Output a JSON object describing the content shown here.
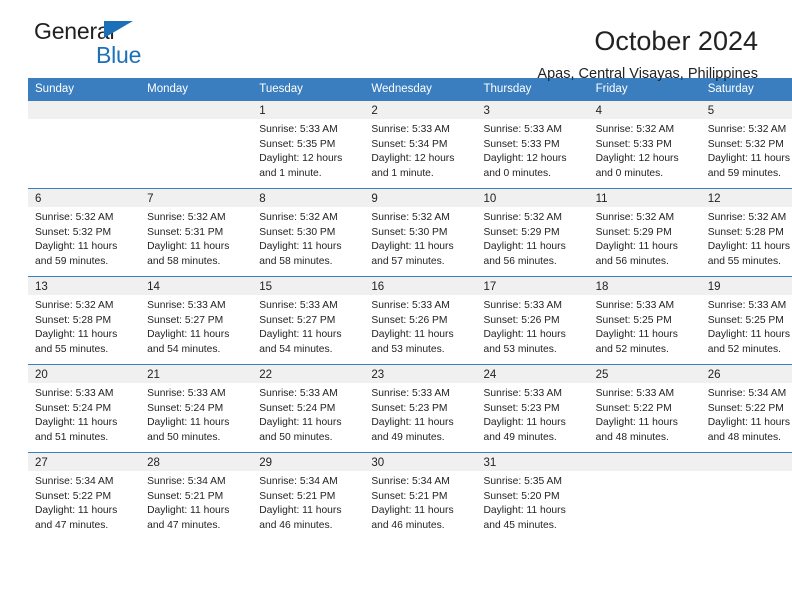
{
  "brand": {
    "line1": "General",
    "line2": "Blue",
    "triangle_color": "#1b70b8",
    "text_color": "#231f20"
  },
  "header": {
    "title": "October 2024",
    "subtitle": "Apas, Central Visayas, Philippines"
  },
  "theme": {
    "header_blue": "#3a7ebf",
    "daynum_bg": "#f0f0f0",
    "grid_line": "#3a7ebf",
    "text": "#232323"
  },
  "calendar": {
    "weekday_headers": [
      "Sunday",
      "Monday",
      "Tuesday",
      "Wednesday",
      "Thursday",
      "Friday",
      "Saturday"
    ],
    "weeks": [
      [
        {
          "day": "",
          "sunrise": "",
          "sunset": "",
          "daylight_line1": "",
          "daylight_line2": ""
        },
        {
          "day": "",
          "sunrise": "",
          "sunset": "",
          "daylight_line1": "",
          "daylight_line2": ""
        },
        {
          "day": "1",
          "sunrise": "Sunrise: 5:33 AM",
          "sunset": "Sunset: 5:35 PM",
          "daylight_line1": "Daylight: 12 hours",
          "daylight_line2": "and 1 minute."
        },
        {
          "day": "2",
          "sunrise": "Sunrise: 5:33 AM",
          "sunset": "Sunset: 5:34 PM",
          "daylight_line1": "Daylight: 12 hours",
          "daylight_line2": "and 1 minute."
        },
        {
          "day": "3",
          "sunrise": "Sunrise: 5:33 AM",
          "sunset": "Sunset: 5:33 PM",
          "daylight_line1": "Daylight: 12 hours",
          "daylight_line2": "and 0 minutes."
        },
        {
          "day": "4",
          "sunrise": "Sunrise: 5:32 AM",
          "sunset": "Sunset: 5:33 PM",
          "daylight_line1": "Daylight: 12 hours",
          "daylight_line2": "and 0 minutes."
        },
        {
          "day": "5",
          "sunrise": "Sunrise: 5:32 AM",
          "sunset": "Sunset: 5:32 PM",
          "daylight_line1": "Daylight: 11 hours",
          "daylight_line2": "and 59 minutes."
        }
      ],
      [
        {
          "day": "6",
          "sunrise": "Sunrise: 5:32 AM",
          "sunset": "Sunset: 5:32 PM",
          "daylight_line1": "Daylight: 11 hours",
          "daylight_line2": "and 59 minutes."
        },
        {
          "day": "7",
          "sunrise": "Sunrise: 5:32 AM",
          "sunset": "Sunset: 5:31 PM",
          "daylight_line1": "Daylight: 11 hours",
          "daylight_line2": "and 58 minutes."
        },
        {
          "day": "8",
          "sunrise": "Sunrise: 5:32 AM",
          "sunset": "Sunset: 5:30 PM",
          "daylight_line1": "Daylight: 11 hours",
          "daylight_line2": "and 58 minutes."
        },
        {
          "day": "9",
          "sunrise": "Sunrise: 5:32 AM",
          "sunset": "Sunset: 5:30 PM",
          "daylight_line1": "Daylight: 11 hours",
          "daylight_line2": "and 57 minutes."
        },
        {
          "day": "10",
          "sunrise": "Sunrise: 5:32 AM",
          "sunset": "Sunset: 5:29 PM",
          "daylight_line1": "Daylight: 11 hours",
          "daylight_line2": "and 56 minutes."
        },
        {
          "day": "11",
          "sunrise": "Sunrise: 5:32 AM",
          "sunset": "Sunset: 5:29 PM",
          "daylight_line1": "Daylight: 11 hours",
          "daylight_line2": "and 56 minutes."
        },
        {
          "day": "12",
          "sunrise": "Sunrise: 5:32 AM",
          "sunset": "Sunset: 5:28 PM",
          "daylight_line1": "Daylight: 11 hours",
          "daylight_line2": "and 55 minutes."
        }
      ],
      [
        {
          "day": "13",
          "sunrise": "Sunrise: 5:32 AM",
          "sunset": "Sunset: 5:28 PM",
          "daylight_line1": "Daylight: 11 hours",
          "daylight_line2": "and 55 minutes."
        },
        {
          "day": "14",
          "sunrise": "Sunrise: 5:33 AM",
          "sunset": "Sunset: 5:27 PM",
          "daylight_line1": "Daylight: 11 hours",
          "daylight_line2": "and 54 minutes."
        },
        {
          "day": "15",
          "sunrise": "Sunrise: 5:33 AM",
          "sunset": "Sunset: 5:27 PM",
          "daylight_line1": "Daylight: 11 hours",
          "daylight_line2": "and 54 minutes."
        },
        {
          "day": "16",
          "sunrise": "Sunrise: 5:33 AM",
          "sunset": "Sunset: 5:26 PM",
          "daylight_line1": "Daylight: 11 hours",
          "daylight_line2": "and 53 minutes."
        },
        {
          "day": "17",
          "sunrise": "Sunrise: 5:33 AM",
          "sunset": "Sunset: 5:26 PM",
          "daylight_line1": "Daylight: 11 hours",
          "daylight_line2": "and 53 minutes."
        },
        {
          "day": "18",
          "sunrise": "Sunrise: 5:33 AM",
          "sunset": "Sunset: 5:25 PM",
          "daylight_line1": "Daylight: 11 hours",
          "daylight_line2": "and 52 minutes."
        },
        {
          "day": "19",
          "sunrise": "Sunrise: 5:33 AM",
          "sunset": "Sunset: 5:25 PM",
          "daylight_line1": "Daylight: 11 hours",
          "daylight_line2": "and 52 minutes."
        }
      ],
      [
        {
          "day": "20",
          "sunrise": "Sunrise: 5:33 AM",
          "sunset": "Sunset: 5:24 PM",
          "daylight_line1": "Daylight: 11 hours",
          "daylight_line2": "and 51 minutes."
        },
        {
          "day": "21",
          "sunrise": "Sunrise: 5:33 AM",
          "sunset": "Sunset: 5:24 PM",
          "daylight_line1": "Daylight: 11 hours",
          "daylight_line2": "and 50 minutes."
        },
        {
          "day": "22",
          "sunrise": "Sunrise: 5:33 AM",
          "sunset": "Sunset: 5:24 PM",
          "daylight_line1": "Daylight: 11 hours",
          "daylight_line2": "and 50 minutes."
        },
        {
          "day": "23",
          "sunrise": "Sunrise: 5:33 AM",
          "sunset": "Sunset: 5:23 PM",
          "daylight_line1": "Daylight: 11 hours",
          "daylight_line2": "and 49 minutes."
        },
        {
          "day": "24",
          "sunrise": "Sunrise: 5:33 AM",
          "sunset": "Sunset: 5:23 PM",
          "daylight_line1": "Daylight: 11 hours",
          "daylight_line2": "and 49 minutes."
        },
        {
          "day": "25",
          "sunrise": "Sunrise: 5:33 AM",
          "sunset": "Sunset: 5:22 PM",
          "daylight_line1": "Daylight: 11 hours",
          "daylight_line2": "and 48 minutes."
        },
        {
          "day": "26",
          "sunrise": "Sunrise: 5:34 AM",
          "sunset": "Sunset: 5:22 PM",
          "daylight_line1": "Daylight: 11 hours",
          "daylight_line2": "and 48 minutes."
        }
      ],
      [
        {
          "day": "27",
          "sunrise": "Sunrise: 5:34 AM",
          "sunset": "Sunset: 5:22 PM",
          "daylight_line1": "Daylight: 11 hours",
          "daylight_line2": "and 47 minutes."
        },
        {
          "day": "28",
          "sunrise": "Sunrise: 5:34 AM",
          "sunset": "Sunset: 5:21 PM",
          "daylight_line1": "Daylight: 11 hours",
          "daylight_line2": "and 47 minutes."
        },
        {
          "day": "29",
          "sunrise": "Sunrise: 5:34 AM",
          "sunset": "Sunset: 5:21 PM",
          "daylight_line1": "Daylight: 11 hours",
          "daylight_line2": "and 46 minutes."
        },
        {
          "day": "30",
          "sunrise": "Sunrise: 5:34 AM",
          "sunset": "Sunset: 5:21 PM",
          "daylight_line1": "Daylight: 11 hours",
          "daylight_line2": "and 46 minutes."
        },
        {
          "day": "31",
          "sunrise": "Sunrise: 5:35 AM",
          "sunset": "Sunset: 5:20 PM",
          "daylight_line1": "Daylight: 11 hours",
          "daylight_line2": "and 45 minutes."
        },
        {
          "day": "",
          "sunrise": "",
          "sunset": "",
          "daylight_line1": "",
          "daylight_line2": ""
        },
        {
          "day": "",
          "sunrise": "",
          "sunset": "",
          "daylight_line1": "",
          "daylight_line2": ""
        }
      ]
    ]
  }
}
